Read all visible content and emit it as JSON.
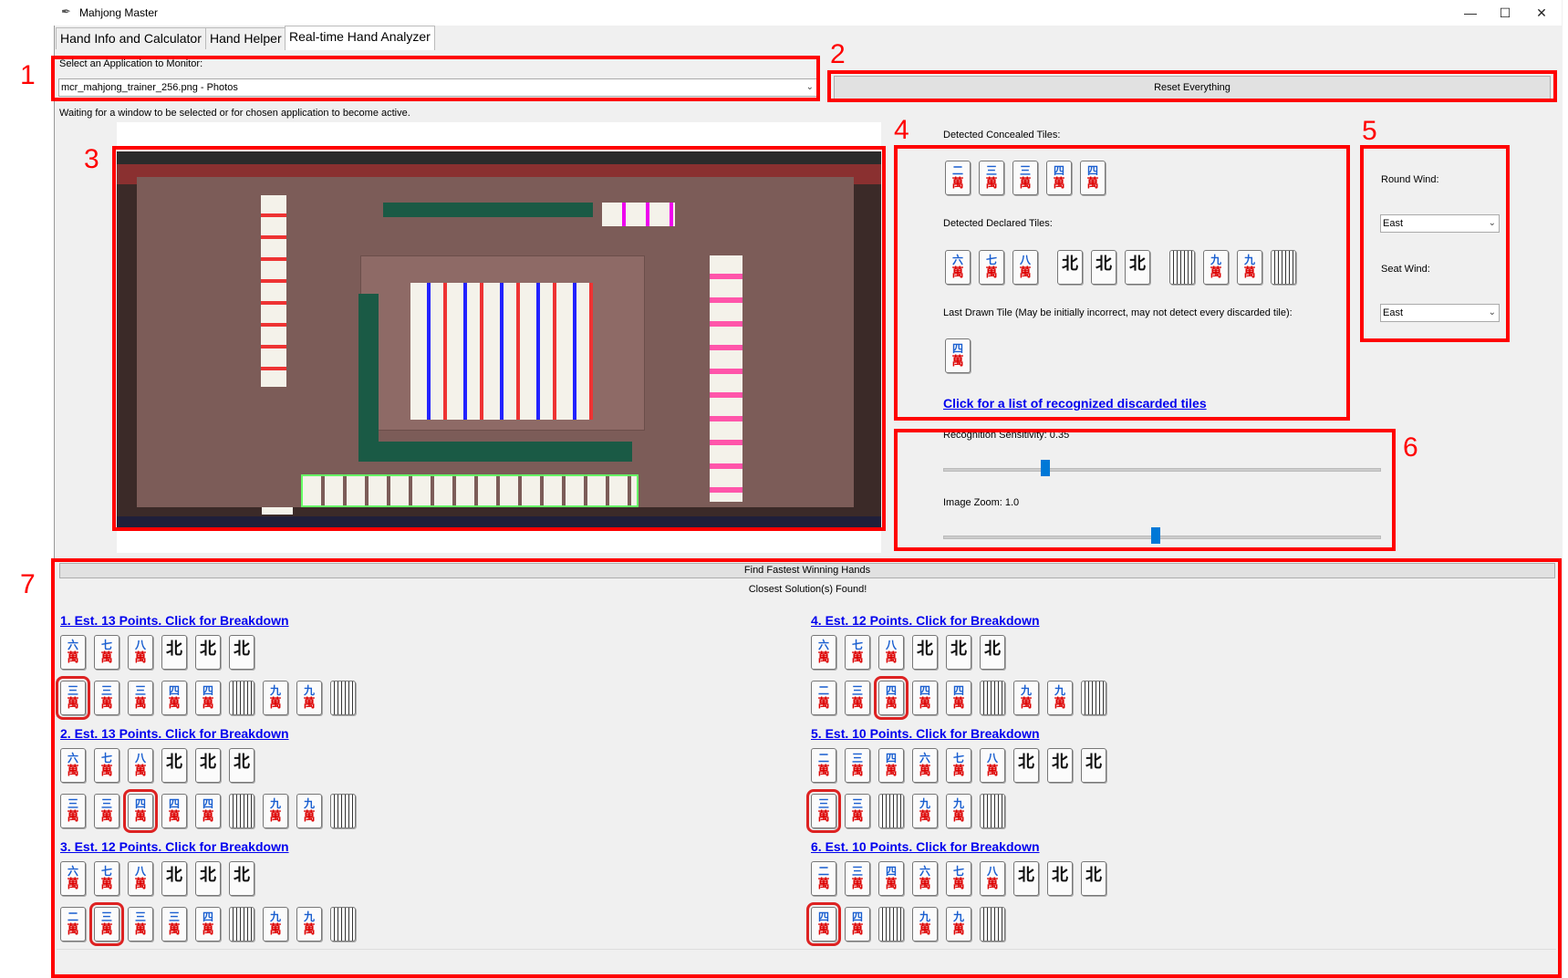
{
  "window": {
    "title": "Mahjong Master",
    "controls": [
      "—",
      "☐",
      "✕"
    ]
  },
  "tabs": [
    "Hand Info and Calculator",
    "Hand Helper",
    "Real-time Hand Analyzer"
  ],
  "annotations": [
    "1",
    "2",
    "3",
    "4",
    "5",
    "6",
    "7"
  ],
  "monitor": {
    "label": "Select an Application to Monitor:",
    "selected": "mcr_mahjong_trainer_256.png - Photos",
    "reset_label": "Reset Everything",
    "status": "Waiting for a window to be selected or for chosen application to become active."
  },
  "detection": {
    "concealed_label": "Detected Concealed Tiles:",
    "concealed": [
      [
        "二",
        "萬"
      ],
      [
        "三",
        "萬"
      ],
      [
        "三",
        "萬"
      ],
      [
        "四",
        "萬"
      ],
      [
        "四",
        "萬"
      ]
    ],
    "declared_label": "Detected Declared Tiles:",
    "declared_groups": [
      [
        [
          "六",
          "萬"
        ],
        [
          "七",
          "萬"
        ],
        [
          "八",
          "萬"
        ]
      ],
      [
        [
          "北",
          ""
        ],
        [
          "北",
          ""
        ],
        [
          "北",
          ""
        ]
      ],
      [
        [
          "",
          ""
        ],
        [
          "九",
          "萬"
        ],
        [
          "九",
          "萬"
        ],
        [
          "",
          ""
        ]
      ]
    ],
    "last_drawn_label": "Last Drawn Tile (May be initially incorrect, may not detect every discarded tile):",
    "last_drawn": [
      "四",
      "萬"
    ],
    "discard_link": "Click for a list of recognized discarded tiles"
  },
  "winds": {
    "round_label": "Round Wind:",
    "round_value": "East",
    "seat_label": "Seat Wind:",
    "seat_value": "East"
  },
  "sliders": {
    "sensitivity_label": "Recognition Sensitivity: 0.35",
    "sensitivity_value": 0.35,
    "zoom_label": "Image Zoom: 1.0",
    "zoom_value": 1.0
  },
  "solutions": {
    "button_label": "Find Fastest Winning Hands",
    "status": "Closest Solution(s) Found!",
    "items": [
      {
        "title": "1. Est. 13 Points. Click for Breakdown",
        "row1": [
          [
            "六",
            "萬"
          ],
          [
            "七",
            "萬"
          ],
          [
            "八",
            "萬"
          ],
          [
            "北",
            ""
          ],
          [
            "北",
            ""
          ],
          [
            "北",
            ""
          ]
        ],
        "row2": [
          [
            "三",
            "萬"
          ],
          [
            "三",
            "萬"
          ],
          [
            "三",
            "萬"
          ],
          [
            "四",
            "萬"
          ],
          [
            "四",
            "萬"
          ],
          [
            "",
            ""
          ],
          [
            "九",
            "萬"
          ],
          [
            "九",
            "萬"
          ],
          [
            "",
            ""
          ]
        ],
        "highlight": 0
      },
      {
        "title": "2. Est. 13 Points. Click for Breakdown",
        "row1": [
          [
            "六",
            "萬"
          ],
          [
            "七",
            "萬"
          ],
          [
            "八",
            "萬"
          ],
          [
            "北",
            ""
          ],
          [
            "北",
            ""
          ],
          [
            "北",
            ""
          ]
        ],
        "row2": [
          [
            "三",
            "萬"
          ],
          [
            "三",
            "萬"
          ],
          [
            "四",
            "萬"
          ],
          [
            "四",
            "萬"
          ],
          [
            "四",
            "萬"
          ],
          [
            "",
            ""
          ],
          [
            "九",
            "萬"
          ],
          [
            "九",
            "萬"
          ],
          [
            "",
            ""
          ]
        ],
        "highlight": 2
      },
      {
        "title": "3. Est. 12 Points. Click for Breakdown",
        "row1": [
          [
            "六",
            "萬"
          ],
          [
            "七",
            "萬"
          ],
          [
            "八",
            "萬"
          ],
          [
            "北",
            ""
          ],
          [
            "北",
            ""
          ],
          [
            "北",
            ""
          ]
        ],
        "row2": [
          [
            "二",
            "萬"
          ],
          [
            "三",
            "萬"
          ],
          [
            "三",
            "萬"
          ],
          [
            "三",
            "萬"
          ],
          [
            "四",
            "萬"
          ],
          [
            "",
            ""
          ],
          [
            "九",
            "萬"
          ],
          [
            "九",
            "萬"
          ],
          [
            "",
            ""
          ]
        ],
        "highlight": 1
      },
      {
        "title": "4. Est. 12 Points. Click for Breakdown",
        "row1": [
          [
            "六",
            "萬"
          ],
          [
            "七",
            "萬"
          ],
          [
            "八",
            "萬"
          ],
          [
            "北",
            ""
          ],
          [
            "北",
            ""
          ],
          [
            "北",
            ""
          ]
        ],
        "row2": [
          [
            "二",
            "萬"
          ],
          [
            "三",
            "萬"
          ],
          [
            "四",
            "萬"
          ],
          [
            "四",
            "萬"
          ],
          [
            "四",
            "萬"
          ],
          [
            "",
            ""
          ],
          [
            "九",
            "萬"
          ],
          [
            "九",
            "萬"
          ],
          [
            "",
            ""
          ]
        ],
        "highlight": 2
      },
      {
        "title": "5. Est. 10 Points. Click for Breakdown",
        "row1": [
          [
            "二",
            "萬"
          ],
          [
            "三",
            "萬"
          ],
          [
            "四",
            "萬"
          ],
          [
            "六",
            "萬"
          ],
          [
            "七",
            "萬"
          ],
          [
            "八",
            "萬"
          ],
          [
            "北",
            ""
          ],
          [
            "北",
            ""
          ],
          [
            "北",
            ""
          ]
        ],
        "row2": [
          [
            "三",
            "萬"
          ],
          [
            "三",
            "萬"
          ],
          [
            "",
            ""
          ],
          [
            "九",
            "萬"
          ],
          [
            "九",
            "萬"
          ],
          [
            "",
            ""
          ]
        ],
        "highlight": 0
      },
      {
        "title": "6. Est. 10 Points. Click for Breakdown",
        "row1": [
          [
            "二",
            "萬"
          ],
          [
            "三",
            "萬"
          ],
          [
            "四",
            "萬"
          ],
          [
            "六",
            "萬"
          ],
          [
            "七",
            "萬"
          ],
          [
            "八",
            "萬"
          ],
          [
            "北",
            ""
          ],
          [
            "北",
            ""
          ],
          [
            "北",
            ""
          ]
        ],
        "row2": [
          [
            "四",
            "萬"
          ],
          [
            "四",
            "萬"
          ],
          [
            "",
            ""
          ],
          [
            "九",
            "萬"
          ],
          [
            "九",
            "萬"
          ],
          [
            "",
            ""
          ]
        ],
        "highlight": 0
      }
    ]
  },
  "colors": {
    "annotation": "#ff0000",
    "link": "#0000ee",
    "slider": "#0078d7",
    "character_red": "#dd0000",
    "character_blue": "#1a5fd0"
  }
}
